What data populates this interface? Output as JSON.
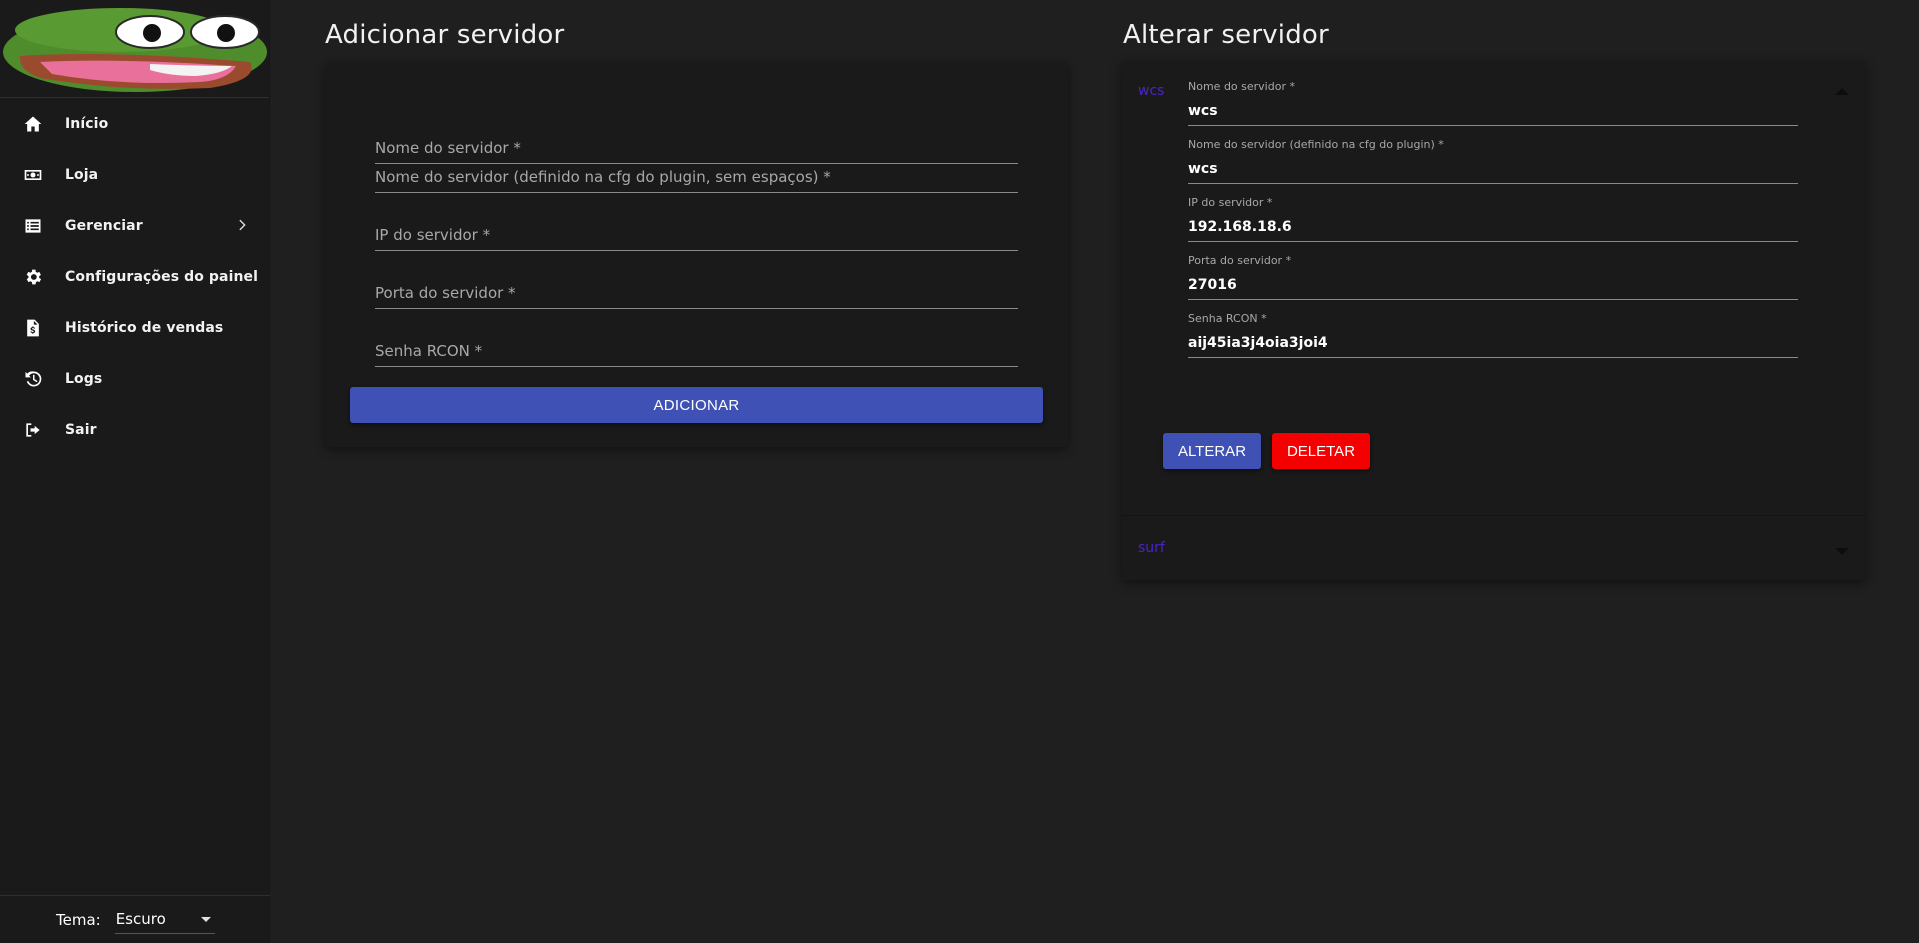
{
  "sidebar": {
    "logo_alt": "pepe-logo",
    "items": [
      {
        "label": "Início",
        "icon": "home-icon"
      },
      {
        "label": "Loja",
        "icon": "money-icon"
      },
      {
        "label": "Gerenciar",
        "icon": "list-icon"
      },
      {
        "label": "Configurações do painel",
        "icon": "gear-icon"
      },
      {
        "label": "Histórico de vendas",
        "icon": "invoice-icon"
      },
      {
        "label": "Logs",
        "icon": "history-icon"
      },
      {
        "label": "Sair",
        "icon": "sign-out-icon"
      }
    ],
    "theme": {
      "label": "Tema:",
      "value": "Escuro"
    }
  },
  "add_server": {
    "title": "Adicionar servidor",
    "fields": [
      {
        "placeholder": "Nome do servidor *"
      },
      {
        "placeholder": "Nome do servidor (definido na cfg do plugin, sem espaços) *"
      },
      {
        "placeholder": "IP do servidor *"
      },
      {
        "placeholder": "Porta do servidor *"
      },
      {
        "placeholder": "Senha RCON *"
      }
    ],
    "button": "ADICIONAR"
  },
  "edit_server": {
    "title": "Alterar servidor",
    "servers": [
      {
        "name": "wcs",
        "expanded": true,
        "fields": [
          {
            "label": "Nome do servidor *",
            "value": "wcs"
          },
          {
            "label": "Nome do servidor (definido na cfg do plugin) *",
            "value": "wcs"
          },
          {
            "label": "IP do servidor *",
            "value": "192.168.18.6"
          },
          {
            "label": "Porta do servidor *",
            "value": "27016"
          },
          {
            "label": "Senha RCON *",
            "value": "aij45ia3j4oia3joi4"
          }
        ],
        "alter_button": "ALTERAR",
        "delete_button": "DELETAR"
      },
      {
        "name": "surf",
        "expanded": false
      }
    ]
  },
  "colors": {
    "background": "#1f1f1f",
    "sidebar": "#1a1a1a",
    "primary": "#3f51b5",
    "danger": "#f40000",
    "accordion_title": "#4a24c9"
  }
}
